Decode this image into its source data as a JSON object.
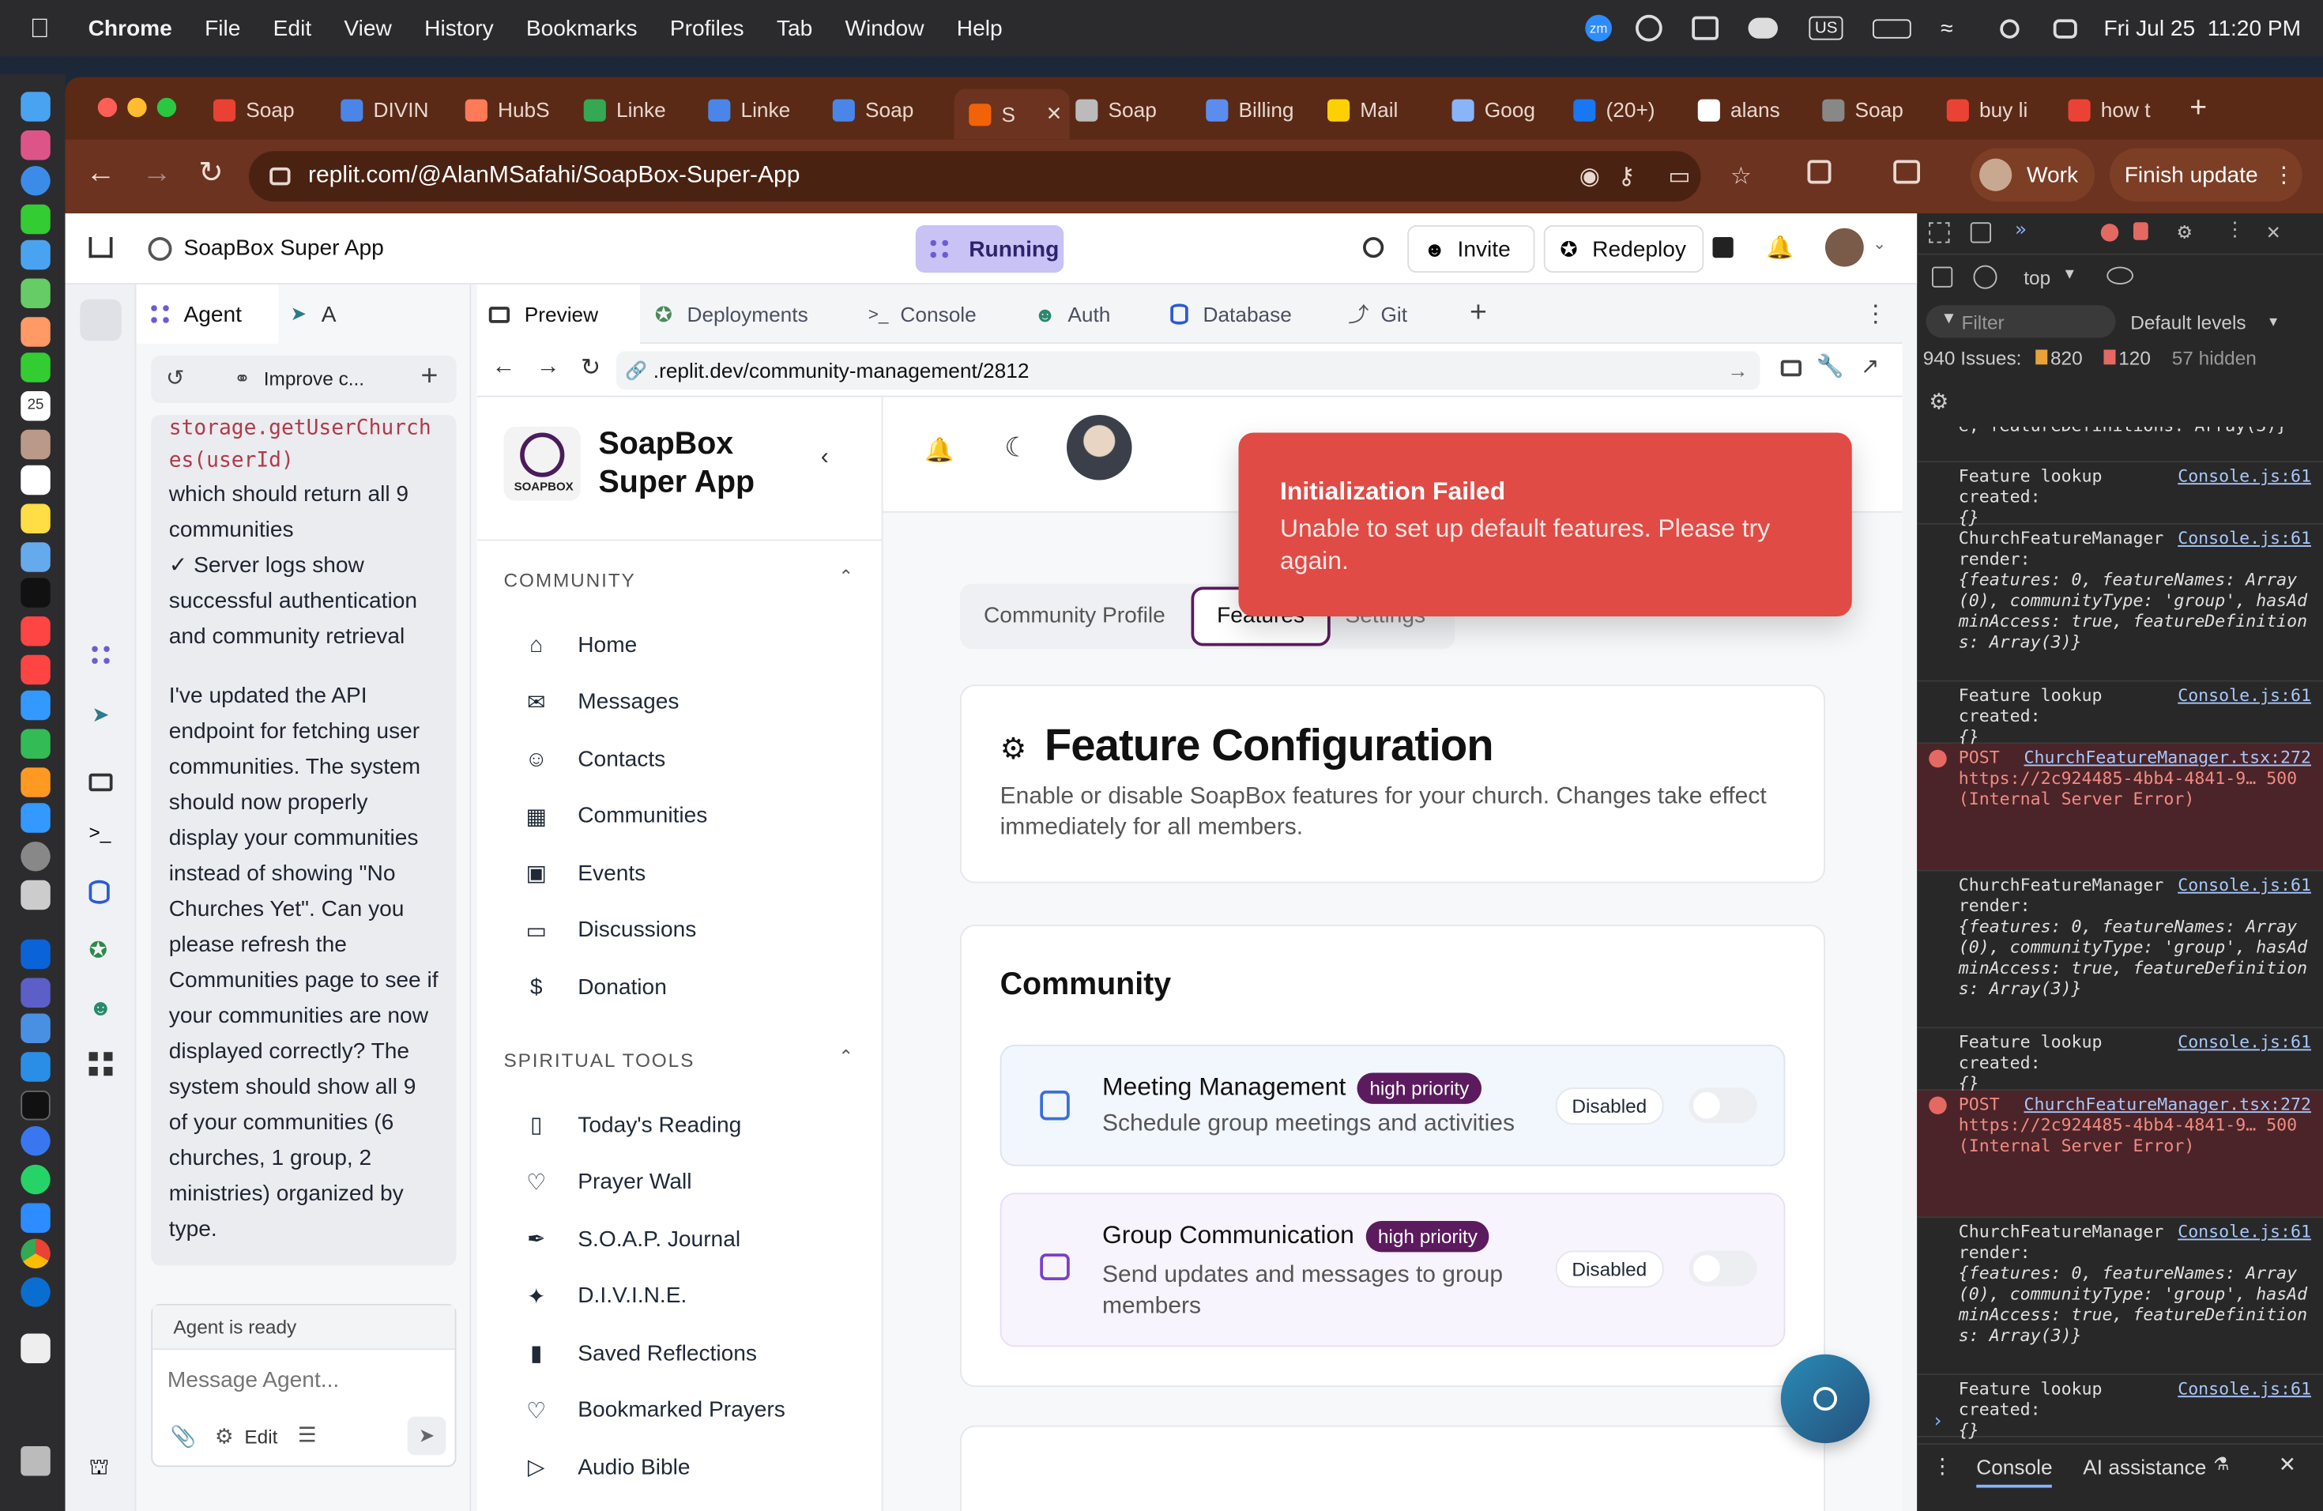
{
  "menubar": {
    "app": "Chrome",
    "items": [
      "File",
      "Edit",
      "View",
      "History",
      "Bookmarks",
      "Profiles",
      "Tab",
      "Window",
      "Help"
    ],
    "clock": "Fri Jul 25  11:20 PM",
    "kbd": "US"
  },
  "tabs": [
    {
      "label": "Soap",
      "color": "#e94235"
    },
    {
      "label": "DIVIN",
      "color": "#4a86e8"
    },
    {
      "label": "HubS",
      "color": "#ff7a59"
    },
    {
      "label": "Linke",
      "color": "#34a853"
    },
    {
      "label": "Linke",
      "color": "#4a86e8"
    },
    {
      "label": "Soap",
      "color": "#4a86e8"
    },
    {
      "label": "S",
      "color": "#f26207"
    },
    {
      "label": "Soap",
      "color": "#bbb"
    },
    {
      "label": "Billing",
      "color": "#5b8def"
    },
    {
      "label": "Mail",
      "color": "#ffd000"
    },
    {
      "label": "Goog",
      "color": "#8ab4f8"
    },
    {
      "label": "(20+)",
      "color": "#1877f2"
    },
    {
      "label": "alans",
      "color": "#fff"
    },
    {
      "label": "Soap",
      "color": "#888"
    },
    {
      "label": "buy li",
      "color": "#ea4335"
    },
    {
      "label": "how t",
      "color": "#ea4335"
    }
  ],
  "address": {
    "url": "replit.com/@AlanMSafahi/SoapBox-Super-App",
    "profile": "Work",
    "update": "Finish update"
  },
  "workspace": {
    "title": "SoapBox Super App",
    "status": "Running",
    "invite": "Invite",
    "redeploy": "Redeploy"
  },
  "agent": {
    "tab": "Agent",
    "tab2": "A",
    "thread": "Improve c...",
    "code": "storage.getUserChurches(userId)",
    "msg1": "which should return all 9 communities",
    "msg2": "✓ Server logs show successful authentication and community retrieval",
    "msg3": "I've updated the API endpoint for fetching user communities. The system should now properly display your communities instead of showing \"No Churches Yet\". Can you please refresh the Communities page to see if your communities are now displayed correctly? The system should show all 9 of your communities (6 churches, 1 group, 2 ministries) organized by type.",
    "status": "Agent is ready",
    "placeholder": "Message Agent...",
    "edit": "Edit"
  },
  "panes": {
    "tabs": [
      "Preview",
      "Deployments",
      "Console",
      "Auth",
      "Database",
      "Git"
    ],
    "url_host": ".replit.dev",
    "url_path": "/community-management/2812"
  },
  "site": {
    "brand1": "SoapBox",
    "brand2": "Super App",
    "logo": "SOAPBOX",
    "sec1": "COMMUNITY",
    "nav1": [
      "Home",
      "Messages",
      "Contacts",
      "Communities",
      "Events",
      "Discussions",
      "Donation"
    ],
    "sec2": "SPIRITUAL TOOLS",
    "nav2": [
      "Today's Reading",
      "Prayer Wall",
      "S.O.A.P. Journal",
      "D.I.V.I.N.E.",
      "Saved Reflections",
      "Bookmarked Prayers",
      "Audio Bible"
    ],
    "tabs": [
      "Community Profile",
      "Features",
      "Settings"
    ],
    "cfg_title": "Feature Configuration",
    "cfg_desc": "Enable or disable SoapBox features for your church. Changes take effect immediately for all members.",
    "section": "Community",
    "features": [
      {
        "name": "Meeting Management",
        "badge": "high priority",
        "desc": "Schedule group meetings and activities",
        "state": "Disabled"
      },
      {
        "name": "Group Communication",
        "badge": "high priority",
        "desc": "Send updates and messages to group members",
        "state": "Disabled"
      }
    ],
    "toast_title": "Initialization Failed",
    "toast_body": "Unable to set up default features. Please try again."
  },
  "devtools": {
    "context": "top",
    "filter": "Filter",
    "levels": "Default levels",
    "issues": "940 Issues:",
    "warn": "820",
    "info": "120",
    "hidden": "57 hidden",
    "drawer": "Console",
    "ai": "AI assistance",
    "logs": [
      {
        "t": "e, featureDefinitions: Array(3)}",
        "k": "frag"
      },
      {
        "t": "Feature lookup created:",
        "l": "Console.js:61",
        "o": "{}",
        "k": "log"
      },
      {
        "t": "ChurchFeatureManager render:",
        "l": "Console.js:61",
        "o": "{features: 0, featureNames: Array(0), communityType: 'group', hasAdminAccess: true, featureDefinitions: Array(3)}",
        "k": "log"
      },
      {
        "t": "Feature lookup created:",
        "l": "Console.js:61",
        "o": "{}",
        "k": "log"
      },
      {
        "t": "POST",
        "l": "ChurchFeatureManager.tsx:272",
        "o": "https://2c924485-4bb4-4841-9… 500 (Internal Server Error)",
        "k": "err"
      },
      {
        "t": "ChurchFeatureManager render:",
        "l": "Console.js:61",
        "o": "{features: 0, featureNames: Array(0), communityType: 'group', hasAdminAccess: true, featureDefinitions: Array(3)}",
        "k": "log"
      },
      {
        "t": "Feature lookup created:",
        "l": "Console.js:61",
        "o": "{}",
        "k": "log"
      },
      {
        "t": "POST",
        "l": "ChurchFeatureManager.tsx:272",
        "o": "https://2c924485-4bb4-4841-9… 500 (Internal Server Error)",
        "k": "err"
      },
      {
        "t": "ChurchFeatureManager render:",
        "l": "Console.js:61",
        "o": "{features: 0, featureNames: Array(0), communityType: 'group', hasAdminAccess: true, featureDefinitions: Array(3)}",
        "k": "log"
      },
      {
        "t": "Feature lookup created:",
        "l": "Console.js:61",
        "o": "{}",
        "k": "log"
      }
    ]
  }
}
